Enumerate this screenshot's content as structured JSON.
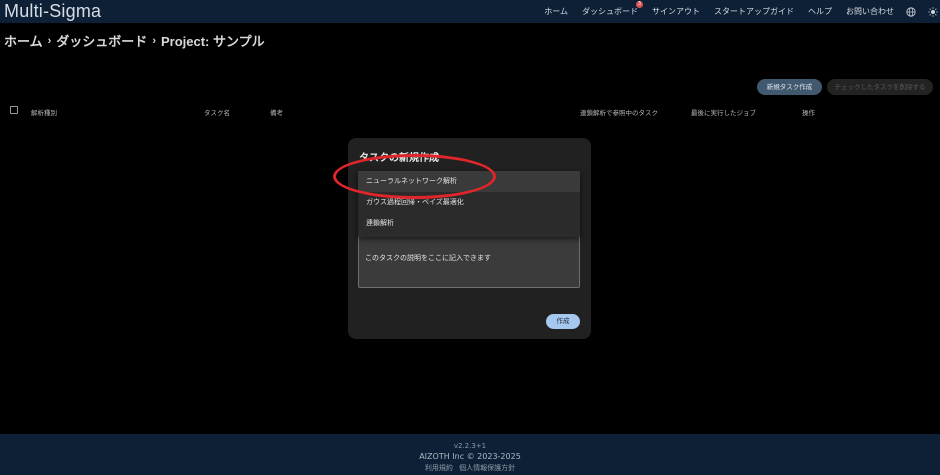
{
  "header": {
    "brand": "Multi-Sigma",
    "nav": [
      {
        "label": "ホーム"
      },
      {
        "label": "ダッシュボード",
        "badge": "3"
      },
      {
        "label": "サインアウト"
      },
      {
        "label": "スタートアップガイド"
      },
      {
        "label": "ヘルプ"
      },
      {
        "label": "お問い合わせ"
      }
    ],
    "icons": [
      "globe-icon",
      "sun-icon"
    ]
  },
  "breadcrumb": {
    "items": [
      "ホーム",
      "ダッシュボード",
      "Project: サンプル"
    ],
    "separator": "›"
  },
  "actions": {
    "new_task": "新規タスク作成",
    "delete_checked": "チェックしたタスクを削除する"
  },
  "table": {
    "headers": [
      "解析種別",
      "タスク名",
      "備考",
      "連鎖解析で参照中のタスク",
      "最後に実行したジョブ",
      "操作"
    ]
  },
  "dialog": {
    "title": "タスクの新規作成",
    "menu_items": [
      "ニューラルネットワーク解析",
      "ガウス過程回帰・ベイズ最適化",
      "連鎖解析"
    ],
    "description": "このタスクの説明をここに記入できます",
    "create_button": "作成"
  },
  "footer": {
    "version": "v2.2.3+1",
    "copyright": "AIZOTH Inc © 2023-2025",
    "links": [
      "利用規約",
      "個人情報保護方針"
    ]
  },
  "colors": {
    "header_bg": "#0e2036",
    "accent_button": "#a7c8ee",
    "annotation": "#e0262a"
  }
}
